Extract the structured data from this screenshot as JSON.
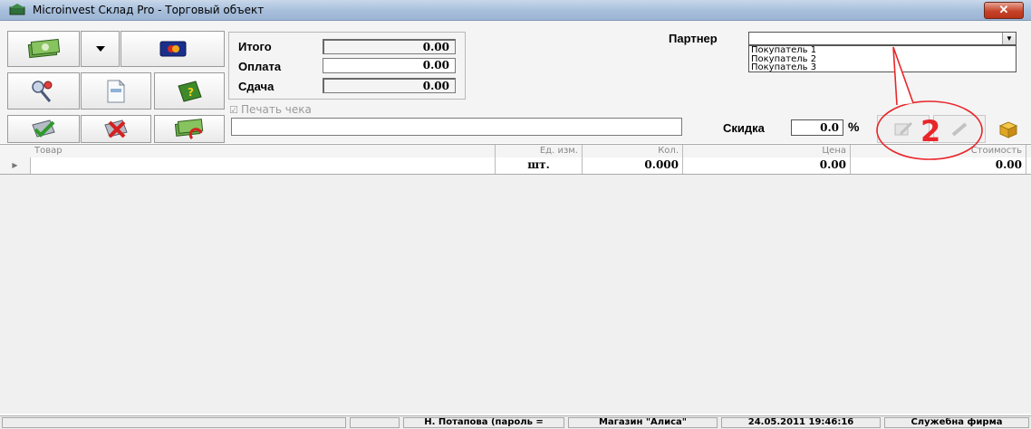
{
  "window": {
    "title": "Microinvest Склад Pro - Торговый объект",
    "close_label": "✕"
  },
  "totals": {
    "total_label": "Итого",
    "total_value": "0.00",
    "payment_label": "Оплата",
    "payment_value": "0.00",
    "change_label": "Сдача",
    "change_value": "0.00"
  },
  "print_check": {
    "label": "Печать чека",
    "checked": true
  },
  "partner": {
    "label": "Партнер",
    "value": "",
    "options": [
      "Покупатель 1",
      "Покупатель 2",
      "Покупатель 3"
    ]
  },
  "discount": {
    "label": "Скидка",
    "value": "0.0",
    "unit": "%"
  },
  "grid": {
    "columns": [
      "Товар",
      "Ед. изм.",
      "Кол.",
      "Цена",
      "Стоимость"
    ],
    "rows": [
      {
        "item": "",
        "unit": "шт.",
        "qty": "0.000",
        "price": "0.00",
        "amount": "0.00"
      }
    ]
  },
  "annotation": {
    "number": "2"
  },
  "status": {
    "user": "Н. Потапова  (пароль =",
    "store": "Магазин \"Алиса\"",
    "datetime": "24.05.2011 19:46:16",
    "company": "Служебна фирма"
  },
  "colors": {
    "title_bg": "#a9c0dc",
    "accent_red": "#e8262a",
    "panel_bg": "#f4f4f4"
  }
}
